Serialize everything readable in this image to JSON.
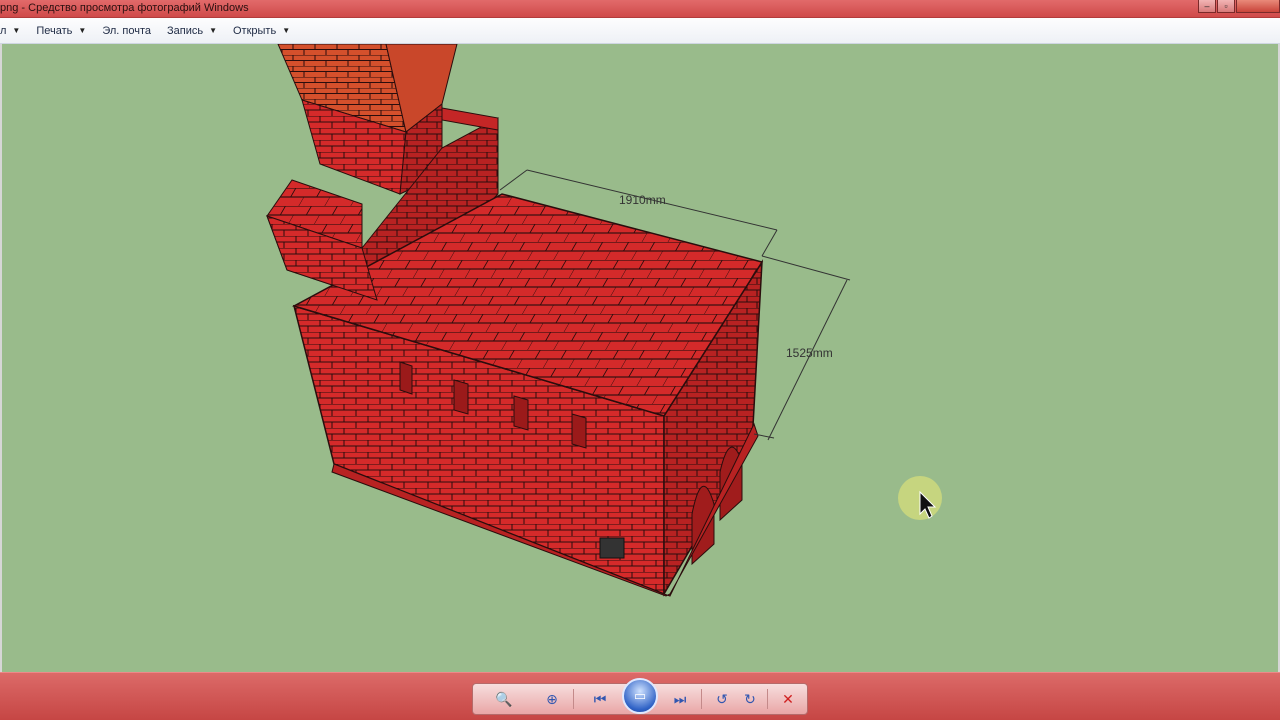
{
  "window": {
    "title": "png - Средство просмотра фотографий Windows",
    "controls": {
      "minimize": "–",
      "maximize": "▫",
      "close": ""
    }
  },
  "menu": {
    "items": [
      {
        "label": "л"
      },
      {
        "label": "Печать"
      },
      {
        "label": "Эл. почта"
      },
      {
        "label": "Запись"
      },
      {
        "label": "Открыть"
      }
    ]
  },
  "image": {
    "dimension_width": "1910mm",
    "dimension_depth": "1525mm",
    "colors": {
      "background": "#99bb8b",
      "brick": "#d52a2a",
      "brick_dark": "#a51c1c",
      "chimney_top": "#d4502c",
      "mortar": "#2a0d0d"
    }
  },
  "bottom_controls": {
    "zoom_icon": "🔍",
    "fit_icon": "⊕",
    "prev_icon": "⏮",
    "slideshow_icon": "▭",
    "next_icon": "⏭",
    "rotate_left_icon": "↺",
    "rotate_right_icon": "↻",
    "delete_icon": "✕"
  }
}
